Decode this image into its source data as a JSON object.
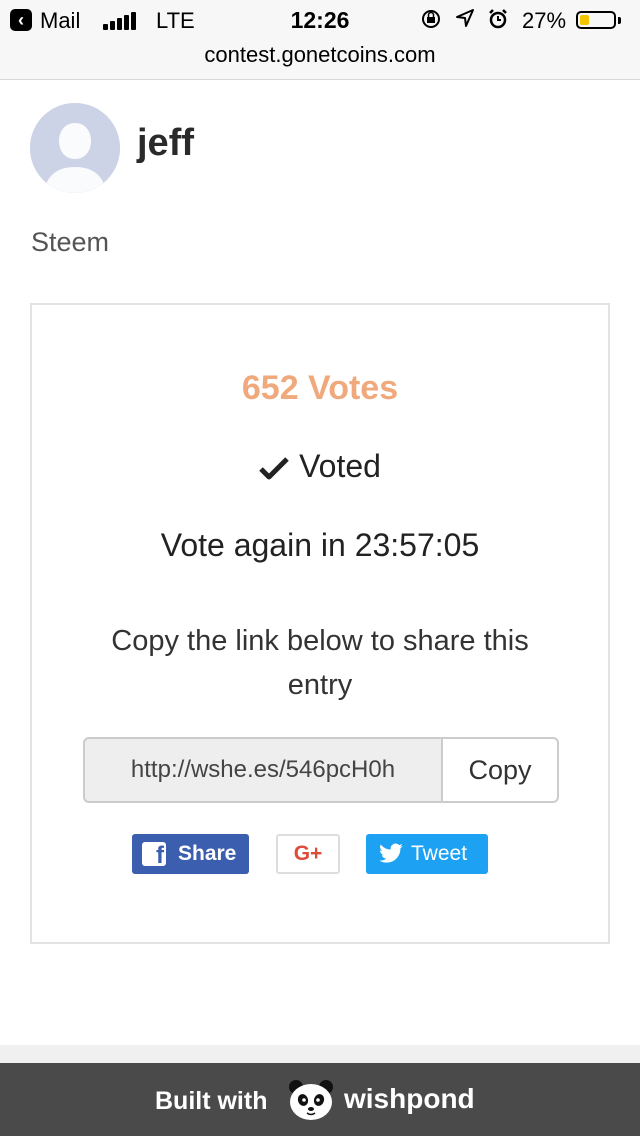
{
  "status_bar": {
    "back_app": "Mail",
    "carrier": "LTE",
    "time": "12:26",
    "battery_percent": "27%",
    "battery_level": 0.27,
    "icons": [
      "back-icon",
      "signal-icon",
      "rotation-lock-icon",
      "location-icon",
      "alarm-icon",
      "battery-icon"
    ]
  },
  "browser": {
    "url": "contest.gonetcoins.com"
  },
  "entry": {
    "username": "jeff",
    "category": "Steem",
    "votes": "652 Votes",
    "voted_label": "Voted",
    "vote_again": "Vote again in 23:57:05",
    "share_text": "Copy the link below to share this entry",
    "share_link": "http://wshe.es/546pcH0h",
    "copy_label": "Copy"
  },
  "share_buttons": {
    "facebook": "Share",
    "google": "G+",
    "twitter": "Tweet"
  },
  "footer": {
    "built_with": "Built with",
    "brand": "wishpond"
  },
  "colors": {
    "votes": "#f0a97c",
    "facebook": "#3b5eae",
    "twitter": "#1da1f2",
    "google": "#dd4b39",
    "footer": "#4a4a4a",
    "battery": "#f5c400"
  }
}
